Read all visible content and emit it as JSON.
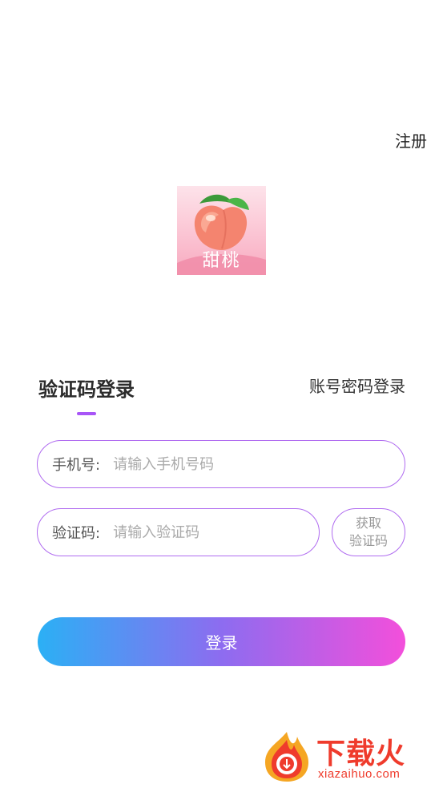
{
  "header": {
    "register_label": "注册"
  },
  "logo": {
    "text": "甜桃"
  },
  "tabs": {
    "sms_login_label": "验证码登录",
    "password_login_label": "账号密码登录"
  },
  "form": {
    "phone": {
      "label": "手机号:",
      "value": "",
      "placeholder": "请输入手机号码"
    },
    "code": {
      "label": "验证码:",
      "value": "",
      "placeholder": "请输入验证码"
    },
    "get_code": {
      "line1": "获取",
      "line2": "验证码"
    },
    "login_label": "登录"
  },
  "watermark": {
    "title": "下载火",
    "url": "xiazaihuo.com"
  },
  "colors": {
    "accent_purple": "#a855f7",
    "field_border": "#b06cf0",
    "login_gradient_start": "#2bb0f5",
    "login_gradient_end": "#f34fdb",
    "watermark_red": "#ef3b2c"
  }
}
